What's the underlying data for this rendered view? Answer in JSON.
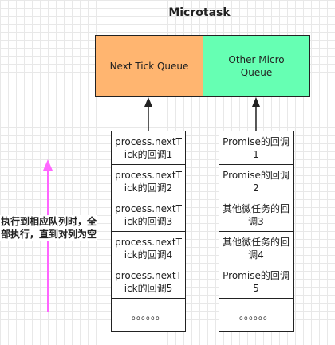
{
  "title": "Microtask",
  "queues": {
    "left": {
      "label": "Next Tick Queue",
      "color": "#FFB570"
    },
    "right": {
      "label": "Other Micro Queue",
      "color": "#66FFB3"
    }
  },
  "left_items": [
    "process.nextTick的回调1",
    "process.nextTick的回调2",
    "process.nextTick的回调3",
    "process.nextTick的回调4",
    "process.nextTick的回调5",
    "。。。。。。"
  ],
  "right_items": [
    "Promise的回调1",
    "Promise的回调2",
    "其他微任务的回调3",
    "其他微任务的回调4",
    "Promise的回调5",
    "。。。。。。"
  ],
  "note": "执行到相应队列时，全部执行，直到对列为空",
  "colors": {
    "arrow_dark": "#222222",
    "arrow_pink": "#FF66FF"
  }
}
